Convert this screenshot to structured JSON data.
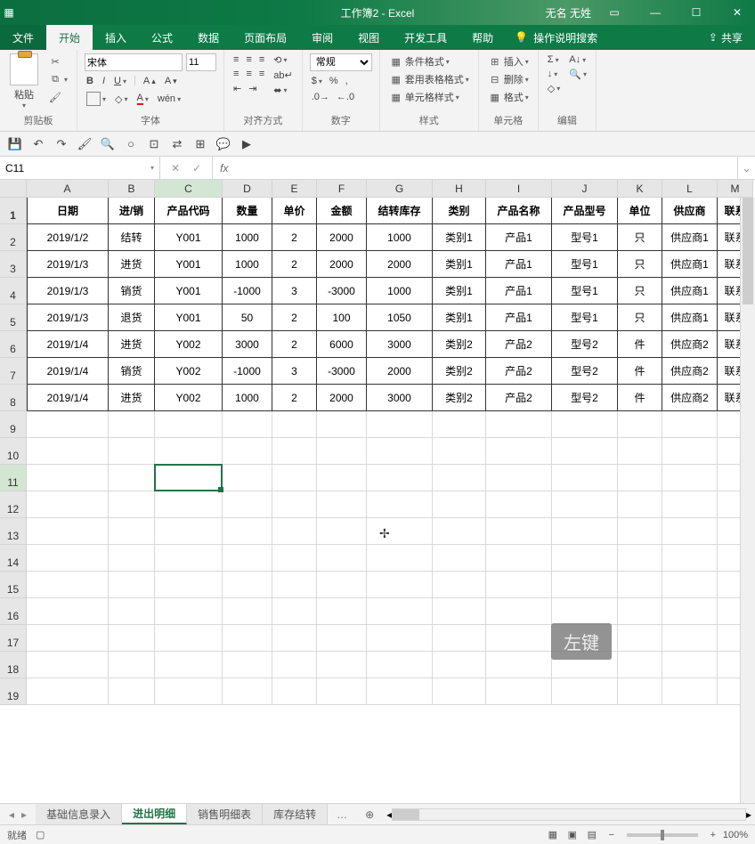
{
  "titlebar": {
    "title": "工作簿2 - Excel",
    "user": "无名 无姓"
  },
  "tabs": {
    "file": "文件",
    "home": "开始",
    "insert": "插入",
    "formulas": "公式",
    "data": "数据",
    "layout": "页面布局",
    "review": "审阅",
    "view": "视图",
    "dev": "开发工具",
    "help": "帮助",
    "tell": "操作说明搜索",
    "share": "共享"
  },
  "ribbon": {
    "clipboard": {
      "paste": "粘贴",
      "label": "剪贴板"
    },
    "font": {
      "name": "宋体",
      "size": "11",
      "label": "字体"
    },
    "align": {
      "label": "对齐方式"
    },
    "number": {
      "format": "常规",
      "label": "数字"
    },
    "styles": {
      "cond": "条件格式",
      "table": "套用表格格式",
      "cell": "单元格样式",
      "label": "样式"
    },
    "cells": {
      "insert": "插入",
      "delete": "删除",
      "format": "格式",
      "label": "单元格"
    },
    "editing": {
      "label": "编辑"
    }
  },
  "namebox": "C11",
  "columns": [
    "A",
    "B",
    "C",
    "D",
    "E",
    "F",
    "G",
    "H",
    "I",
    "J",
    "K",
    "L",
    "M"
  ],
  "headers": [
    "日期",
    "进/销",
    "产品代码",
    "数量",
    "单价",
    "金额",
    "结转库存",
    "类别",
    "产品名称",
    "产品型号",
    "单位",
    "供应商",
    "联系"
  ],
  "rows": [
    [
      "2019/1/2",
      "结转",
      "Y001",
      "1000",
      "2",
      "2000",
      "1000",
      "类别1",
      "产品1",
      "型号1",
      "只",
      "供应商1",
      "联系"
    ],
    [
      "2019/1/3",
      "进货",
      "Y001",
      "1000",
      "2",
      "2000",
      "2000",
      "类别1",
      "产品1",
      "型号1",
      "只",
      "供应商1",
      "联系"
    ],
    [
      "2019/1/3",
      "销货",
      "Y001",
      "-1000",
      "3",
      "-3000",
      "1000",
      "类别1",
      "产品1",
      "型号1",
      "只",
      "供应商1",
      "联系"
    ],
    [
      "2019/1/3",
      "退货",
      "Y001",
      "50",
      "2",
      "100",
      "1050",
      "类别1",
      "产品1",
      "型号1",
      "只",
      "供应商1",
      "联系"
    ],
    [
      "2019/1/4",
      "进货",
      "Y002",
      "3000",
      "2",
      "6000",
      "3000",
      "类别2",
      "产品2",
      "型号2",
      "件",
      "供应商2",
      "联系"
    ],
    [
      "2019/1/4",
      "销货",
      "Y002",
      "-1000",
      "3",
      "-3000",
      "2000",
      "类别2",
      "产品2",
      "型号2",
      "件",
      "供应商2",
      "联系"
    ],
    [
      "2019/1/4",
      "进货",
      "Y002",
      "1000",
      "2",
      "2000",
      "3000",
      "类别2",
      "产品2",
      "型号2",
      "件",
      "供应商2",
      "联系"
    ]
  ],
  "sheets": {
    "s1": "基础信息录入",
    "s2": "进出明细",
    "s3": "销售明细表",
    "s4": "库存结转"
  },
  "status": {
    "ready": "就绪",
    "zoom": "100%"
  },
  "watermark": "左键"
}
